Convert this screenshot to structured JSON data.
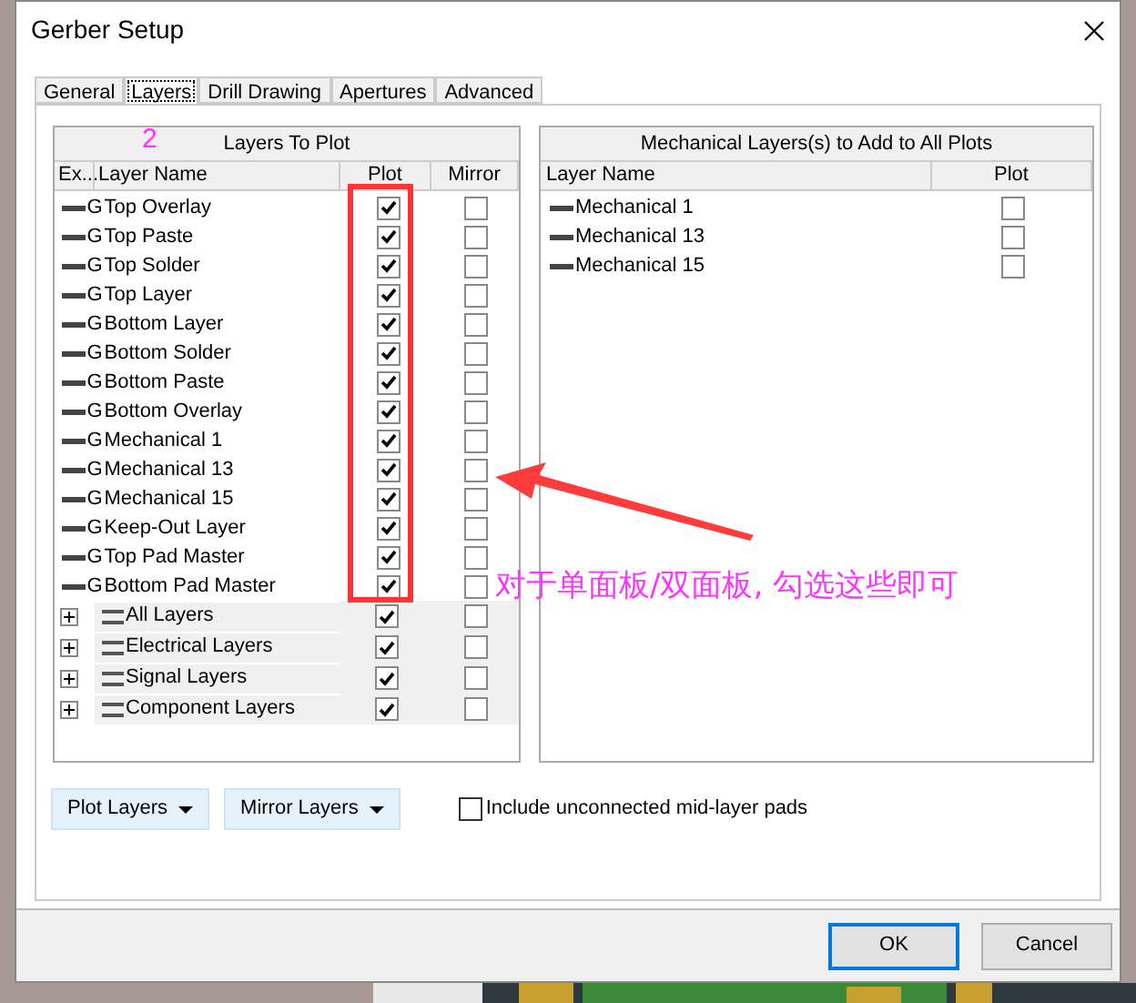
{
  "window": {
    "title": "Gerber Setup"
  },
  "tabs": [
    {
      "label": "General",
      "selected": false
    },
    {
      "label": "Layers",
      "selected": true
    },
    {
      "label": "Drill Drawing",
      "selected": false
    },
    {
      "label": "Apertures",
      "selected": false
    },
    {
      "label": "Advanced",
      "selected": false
    }
  ],
  "layers_panel": {
    "title": "Layers To Plot",
    "columns": [
      "Ex...",
      "Layer Name",
      "Plot",
      "Mirror"
    ],
    "rows": [
      {
        "kind": "layer",
        "marker": "G",
        "name": "Top Overlay",
        "plot": true,
        "mirror": false
      },
      {
        "kind": "layer",
        "marker": "G",
        "name": "Top Paste",
        "plot": true,
        "mirror": false
      },
      {
        "kind": "layer",
        "marker": "G",
        "name": "Top Solder",
        "plot": true,
        "mirror": false
      },
      {
        "kind": "layer",
        "marker": "G",
        "name": "Top Layer",
        "plot": true,
        "mirror": false
      },
      {
        "kind": "layer",
        "marker": "G",
        "name": "Bottom Layer",
        "plot": true,
        "mirror": false
      },
      {
        "kind": "layer",
        "marker": "G",
        "name": "Bottom Solder",
        "plot": true,
        "mirror": false
      },
      {
        "kind": "layer",
        "marker": "G",
        "name": "Bottom Paste",
        "plot": true,
        "mirror": false
      },
      {
        "kind": "layer",
        "marker": "G",
        "name": "Bottom Overlay",
        "plot": true,
        "mirror": false
      },
      {
        "kind": "layer",
        "marker": "G",
        "name": "Mechanical 1",
        "plot": true,
        "mirror": false
      },
      {
        "kind": "layer",
        "marker": "G",
        "name": "Mechanical 13",
        "plot": true,
        "mirror": false
      },
      {
        "kind": "layer",
        "marker": "G",
        "name": "Mechanical 15",
        "plot": true,
        "mirror": false
      },
      {
        "kind": "layer",
        "marker": "G",
        "name": "Keep-Out Layer",
        "plot": true,
        "mirror": false
      },
      {
        "kind": "layer",
        "marker": "G",
        "name": "Top Pad Master",
        "plot": true,
        "mirror": false
      },
      {
        "kind": "layer",
        "marker": "G",
        "name": "Bottom Pad Master",
        "plot": true,
        "mirror": false
      },
      {
        "kind": "group",
        "name": "All Layers",
        "plot": true,
        "mirror": false,
        "expanded": false
      },
      {
        "kind": "group",
        "name": "Electrical Layers",
        "plot": true,
        "mirror": false,
        "expanded": false
      },
      {
        "kind": "group",
        "name": "Signal Layers",
        "plot": true,
        "mirror": false,
        "expanded": false
      },
      {
        "kind": "group",
        "name": "Component Layers",
        "plot": true,
        "mirror": false,
        "expanded": false
      }
    ]
  },
  "mechanical_panel": {
    "title": "Mechanical Layers(s) to Add to All Plots",
    "columns": [
      "Layer Name",
      "Plot"
    ],
    "rows": [
      {
        "name": "Mechanical 1",
        "plot": false
      },
      {
        "name": "Mechanical 13",
        "plot": false
      },
      {
        "name": "Mechanical 15",
        "plot": false
      }
    ]
  },
  "buttons": [
    {
      "label": "Plot Layers"
    },
    {
      "label": "Mirror Layers"
    }
  ],
  "include_unconnected": {
    "label": "Include unconnected mid-layer pads",
    "checked": false
  },
  "footer_buttons": [
    {
      "label": "OK",
      "default": true
    },
    {
      "label": "Cancel",
      "default": false
    }
  ],
  "annotations": {
    "step": "2",
    "note": "对于单面板/双面板, 勾选这些即可"
  }
}
